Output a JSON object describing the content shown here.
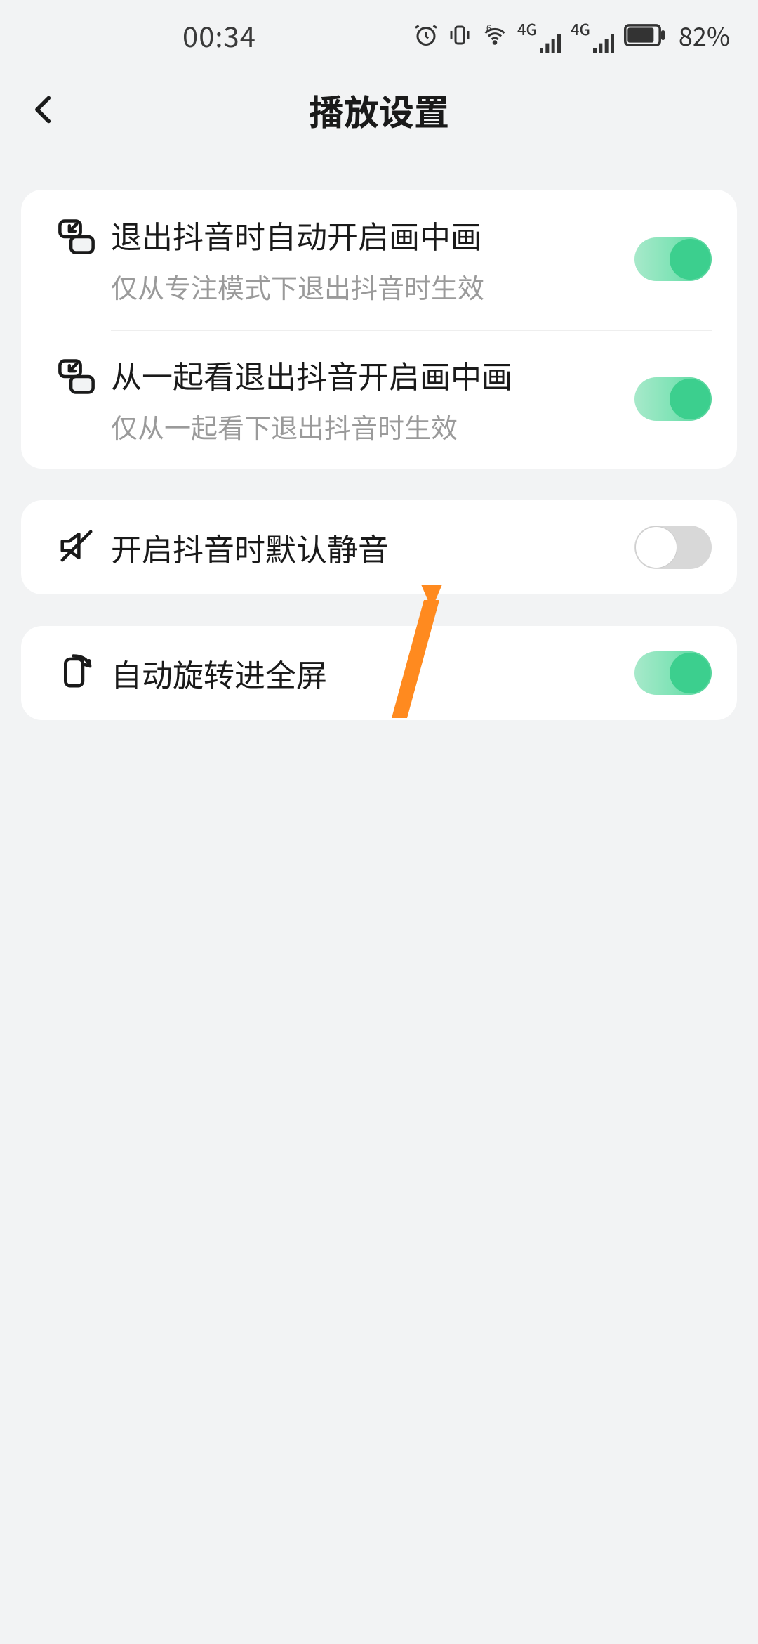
{
  "status": {
    "time": "00:34",
    "battery_pct": "82%"
  },
  "header": {
    "title": "播放设置"
  },
  "groups": [
    {
      "rows": [
        {
          "icon": "pip-icon",
          "label": "退出抖音时自动开启画中画",
          "sub": "仅从专注模式下退出抖音时生效",
          "on": true
        },
        {
          "icon": "pip-icon",
          "label": "从一起看退出抖音开启画中画",
          "sub": "仅从一起看下退出抖音时生效",
          "on": true
        }
      ]
    },
    {
      "rows": [
        {
          "icon": "mute-icon",
          "label": "开启抖音时默认静音",
          "sub": null,
          "on": false
        }
      ]
    },
    {
      "rows": [
        {
          "icon": "rotate-icon",
          "label": "自动旋转进全屏",
          "sub": null,
          "on": true
        }
      ]
    }
  ],
  "colors": {
    "accent_on": "#3ccf8e"
  }
}
